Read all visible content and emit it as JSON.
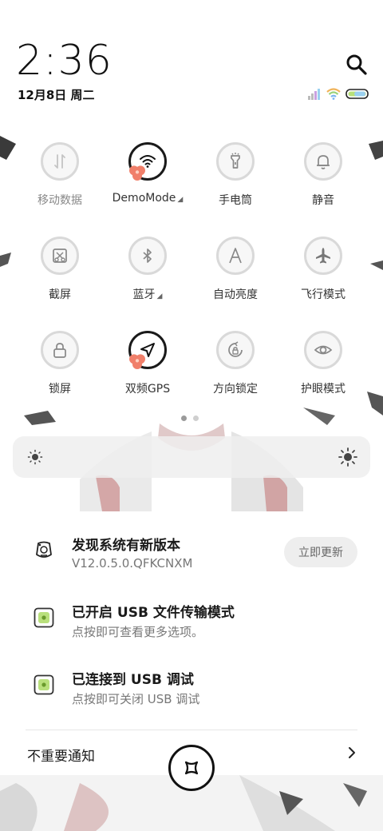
{
  "status": {
    "time": "2:36",
    "date": "12月8日 周二"
  },
  "tiles": [
    {
      "label": "移动数据",
      "icon": "mobile-data-icon",
      "active": false,
      "dim": true,
      "has_arrow": false
    },
    {
      "label": "DemoMode",
      "icon": "wifi-icon",
      "active": true,
      "dim": false,
      "has_arrow": true
    },
    {
      "label": "手电筒",
      "icon": "flashlight-icon",
      "active": false,
      "dim": false,
      "has_arrow": false
    },
    {
      "label": "静音",
      "icon": "bell-icon",
      "active": false,
      "dim": false,
      "has_arrow": false
    },
    {
      "label": "截屏",
      "icon": "screenshot-icon",
      "active": false,
      "dim": false,
      "has_arrow": false
    },
    {
      "label": "蓝牙",
      "icon": "bluetooth-icon",
      "active": false,
      "dim": false,
      "has_arrow": true
    },
    {
      "label": "自动亮度",
      "icon": "auto-brightness-icon",
      "active": false,
      "dim": false,
      "has_arrow": false
    },
    {
      "label": "飞行模式",
      "icon": "airplane-icon",
      "active": false,
      "dim": false,
      "has_arrow": false
    },
    {
      "label": "锁屏",
      "icon": "lock-icon",
      "active": false,
      "dim": false,
      "has_arrow": false
    },
    {
      "label": "双频GPS",
      "icon": "gps-icon",
      "active": true,
      "dim": false,
      "has_arrow": false
    },
    {
      "label": "方向锁定",
      "icon": "rotation-lock-icon",
      "active": false,
      "dim": false,
      "has_arrow": false
    },
    {
      "label": "护眼模式",
      "icon": "eye-icon",
      "active": false,
      "dim": false,
      "has_arrow": false
    }
  ],
  "pager": {
    "current": 1,
    "total": 2
  },
  "notifications": [
    {
      "title": "发现系统有新版本",
      "subtitle": "V12.0.5.0.QFKCNXM",
      "action": "立即更新",
      "icon": "update-icon"
    },
    {
      "title": "已开启 USB 文件传输模式",
      "subtitle": "点按即可查看更多选项。",
      "icon": "android-debug-icon"
    },
    {
      "title": "已连接到 USB 调试",
      "subtitle": "点按即可关闭 USB 调试",
      "icon": "android-debug-icon"
    }
  ],
  "unimportant": {
    "label": "不重要通知"
  },
  "colors": {
    "accent": "#1a1a1a",
    "tile_border": "#d9d9d9",
    "blob": "#f07f6a"
  }
}
